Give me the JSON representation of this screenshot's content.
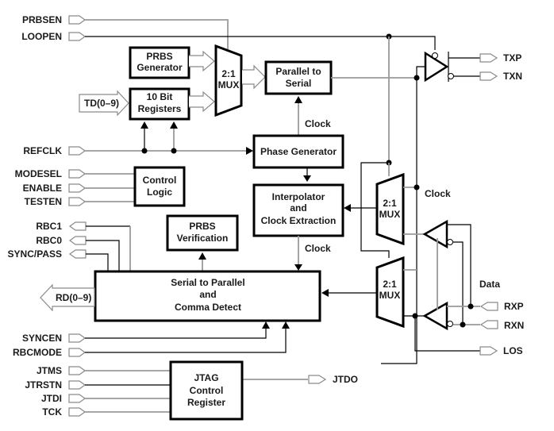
{
  "diagram": {
    "type": "block-diagram",
    "inputs_left": {
      "prbsen": "PRBSEN",
      "loopen": "LOOPEN",
      "td": "TD(0–9)",
      "refclk": "REFCLK",
      "modesel": "MODESEL",
      "enable": "ENABLE",
      "testen": "TESTEN",
      "syncen": "SYNCEN",
      "rbcmode": "RBCMODE",
      "jtms": "JTMS",
      "jtrstn": "JTRSTN",
      "jtdi": "JTDI",
      "tck": "TCK"
    },
    "outputs_left": {
      "rbc1": "RBC1",
      "rbc0": "RBC0",
      "sync_pass": "SYNC/PASS",
      "rd": "RD(0–9)"
    },
    "outputs_right": {
      "txp": "TXP",
      "txn": "TXN",
      "los": "LOS",
      "jtdo": "JTDO"
    },
    "inputs_right": {
      "rxp": "RXP",
      "rxn": "RXN"
    },
    "blocks": {
      "prbs_gen": [
        "PRBS",
        "Generator"
      ],
      "ten_bit": [
        "10 Bit",
        "Registers"
      ],
      "mux_tx": [
        "2:1",
        "MUX"
      ],
      "par_ser": [
        "Parallel to",
        "Serial"
      ],
      "phase_gen": "Phase Generator",
      "ctrl_logic": [
        "Control",
        "Logic"
      ],
      "interp": [
        "Interpolator",
        "and",
        "Clock  Extraction"
      ],
      "prbs_ver": [
        "PRBS",
        "Verification"
      ],
      "ser_par": [
        "Serial to Parallel",
        "and",
        "Comma Detect"
      ],
      "mux_clk": [
        "2:1",
        "MUX"
      ],
      "mux_data": [
        "2:1",
        "MUX"
      ],
      "jtag": [
        "JTAG",
        "Control",
        "Register"
      ]
    },
    "signal_labels": {
      "clock_top": "Clock",
      "clock_mid": "Clock",
      "clock_right": "Clock",
      "data": "Data"
    }
  }
}
